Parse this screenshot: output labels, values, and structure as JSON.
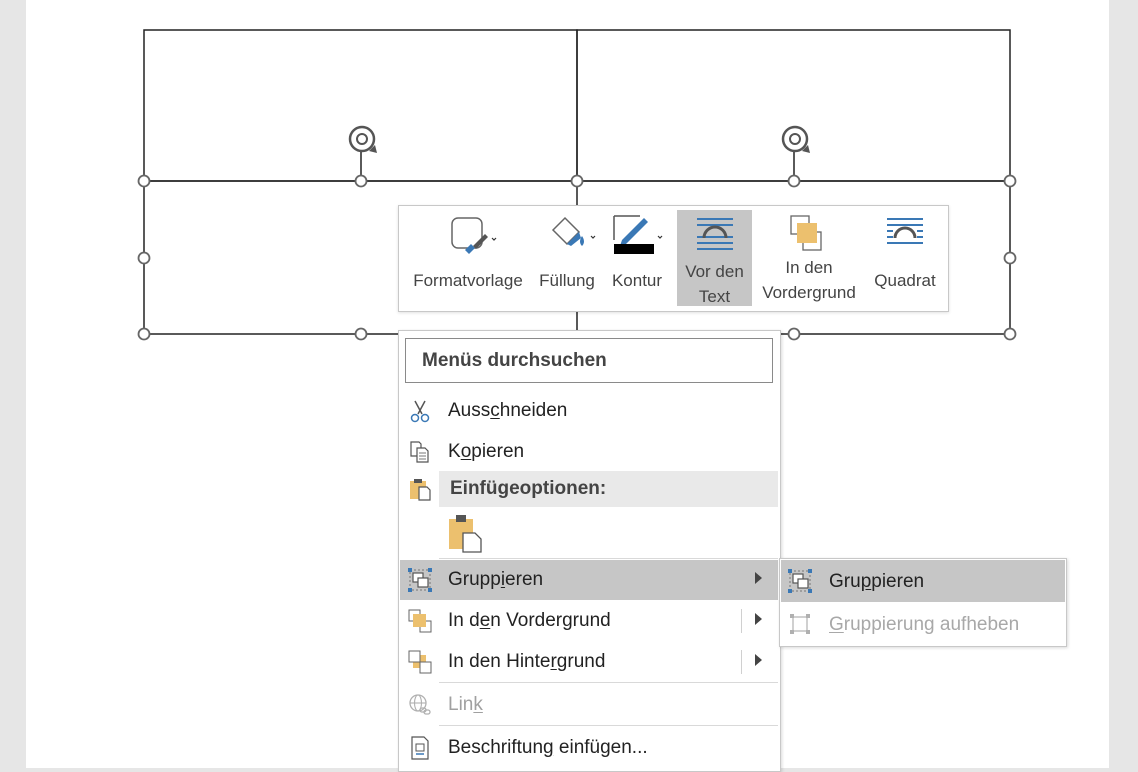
{
  "mini_toolbar": {
    "formatvorlage": "Formatvorlage",
    "fuellung": "Füllung",
    "kontur": "Kontur",
    "vor_den_text_1": "Vor den",
    "vor_den_text_2": "Text",
    "in_den_vordergrund_1": "In den",
    "in_den_vordergrund_2": "Vordergrund",
    "quadrat": "Quadrat"
  },
  "context_menu": {
    "search_label": "Menüs durchsuchen",
    "ausschneiden": {
      "pre": "Auss",
      "acc": "c",
      "post": "hneiden"
    },
    "kopieren": {
      "pre": "K",
      "acc": "o",
      "post": "pieren"
    },
    "einfuegeoptionen": "Einfügeoptionen:",
    "gruppieren": {
      "pre": "Grupp",
      "acc": "i",
      "post": "eren"
    },
    "in_den_vordergrund": {
      "pre": "In d",
      "acc": "e",
      "post": "n Vordergrund"
    },
    "in_den_hintergrund": {
      "pre": "In den Hinte",
      "acc": "r",
      "post": "grund"
    },
    "link": {
      "pre": "Lin",
      "acc": "k",
      "post": ""
    },
    "beschriftung": {
      "pre": "Beschriftun",
      "acc": "g",
      "post": " einfügen..."
    }
  },
  "submenu": {
    "gruppieren": {
      "pre": "Gru",
      "acc": "p",
      "post": "pieren"
    },
    "gruppierung_aufheben": {
      "pre": "",
      "acc": "G",
      "post": "ruppierung aufheben"
    }
  },
  "colors": {
    "page_bg": "#e6e6e6",
    "highlight": "#c6c6c6",
    "icon_blue": "#3a78b5",
    "icon_orange": "#ecc06e"
  }
}
